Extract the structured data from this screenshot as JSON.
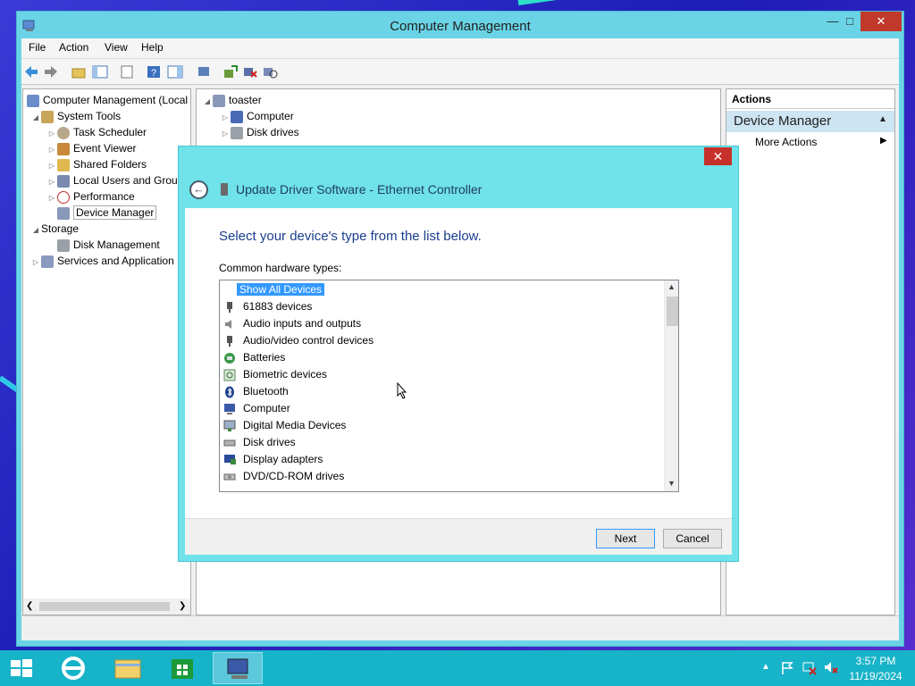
{
  "window": {
    "title": "Computer Management",
    "buttons": {
      "minimize": "—",
      "maximize": "□",
      "close": "✕"
    }
  },
  "menubar": {
    "items": [
      "File",
      "Action",
      "View",
      "Help"
    ]
  },
  "tree": {
    "root": "Computer Management (Local",
    "system_tools": "System Tools",
    "task_scheduler": "Task Scheduler",
    "event_viewer": "Event Viewer",
    "shared_folders": "Shared Folders",
    "local_users": "Local Users and Grou",
    "performance": "Performance",
    "device_manager": "Device Manager",
    "storage": "Storage",
    "disk_management": "Disk Management",
    "services": "Services and Application"
  },
  "devtree": {
    "host": "toaster",
    "computer": "Computer",
    "disk_drives": "Disk drives"
  },
  "actions": {
    "header": "Actions",
    "section": "Device Manager",
    "more_actions": "More Actions"
  },
  "dialog": {
    "title": "Update Driver Software - Ethernet Controller",
    "instruction": "Select your device's type from the list below.",
    "list_label": "Common hardware types:",
    "items": [
      {
        "label": "Show All Devices",
        "icon": "none"
      },
      {
        "label": "61883 devices",
        "icon": "plug-icon"
      },
      {
        "label": "Audio inputs and outputs",
        "icon": "speaker-icon"
      },
      {
        "label": "Audio/video control devices",
        "icon": "plug-icon"
      },
      {
        "label": "Batteries",
        "icon": "battery-icon"
      },
      {
        "label": "Biometric devices",
        "icon": "fingerprint-icon"
      },
      {
        "label": "Bluetooth",
        "icon": "bluetooth-icon"
      },
      {
        "label": "Computer",
        "icon": "computer-icon"
      },
      {
        "label": "Digital Media Devices",
        "icon": "monitor-icon"
      },
      {
        "label": "Disk drives",
        "icon": "disk-icon"
      },
      {
        "label": "Display adapters",
        "icon": "display-icon"
      },
      {
        "label": "DVD/CD-ROM drives",
        "icon": "dvd-icon"
      }
    ],
    "next_label": "Next",
    "cancel_label": "Cancel",
    "close": "✕"
  },
  "taskbar": {
    "time": "3:57 PM",
    "date": "11/19/2024"
  },
  "colors": {
    "dialog_frame": "#6fe2ea",
    "selection": "#3399ff",
    "taskbar": "#17b3c8",
    "instruction_text": "#1a3e8c"
  }
}
